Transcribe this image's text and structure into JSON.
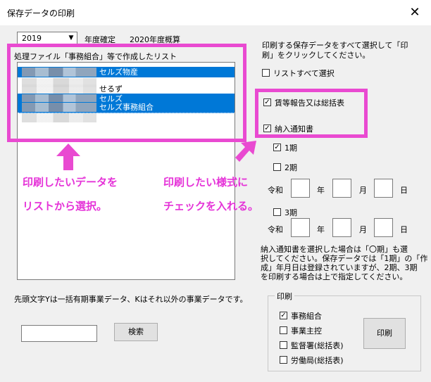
{
  "window": {
    "title": "保存データの印刷",
    "close_icon": "close-icon"
  },
  "year_select": {
    "value": "2019"
  },
  "year_confirmed_label": "年度確定",
  "summary_label": "2020年度概算",
  "list_caption": "処理ファイル「事務組合」等で作成したリスト",
  "list_items": [
    {
      "text": "セルズ物産",
      "selected": true
    },
    {
      "text": "",
      "selected": false
    },
    {
      "text": "せるず",
      "selected": false
    },
    {
      "text": "セルズ",
      "selected": true
    },
    {
      "text": "セルズ事務組合",
      "selected": true
    },
    {
      "text": "",
      "selected": false
    }
  ],
  "instruction": [
    "印刷する保存データをすべて選択して「印",
    "刷」をクリックしてください。"
  ],
  "select_all": {
    "label": "リストすべて選択",
    "checked": false
  },
  "forms": [
    {
      "label": "賃等報告又は総括表",
      "checked": true
    },
    {
      "label": "納入通知書",
      "checked": true
    }
  ],
  "period1": {
    "label": "1期",
    "checked": true
  },
  "period2": {
    "label": "2期",
    "checked": false
  },
  "period3": {
    "label": "3期",
    "checked": false
  },
  "date_labels": {
    "era": "令和",
    "year": "年",
    "month": "月",
    "day": "日"
  },
  "note": [
    "納入通知書を選択した場合は「〇期」も選",
    "択してください。保存データでは「1期」の「作",
    "成」年月日は登録されていますが、2期、3期",
    "を印刷する場合は上で指定してください。"
  ],
  "footer_note": "先頭文字Yは一括有期事業データ、Kはそれ以外の事業データです。",
  "search": {
    "value": "",
    "button_label": "検索"
  },
  "print_group": {
    "title": "印刷",
    "options": [
      {
        "label": "事務組合",
        "checked": true
      },
      {
        "label": "事業主控",
        "checked": false
      },
      {
        "label": "監督署(総括表)",
        "checked": false
      },
      {
        "label": "労働局(総括表)",
        "checked": false
      }
    ],
    "button_label": "印刷"
  },
  "annotations": {
    "left_line1": "印刷したいデータを",
    "left_line2": "リストから選択。",
    "right_line1": "印刷したい様式に",
    "right_line2": "チェックを入れる。",
    "color": "#e94ad1"
  }
}
